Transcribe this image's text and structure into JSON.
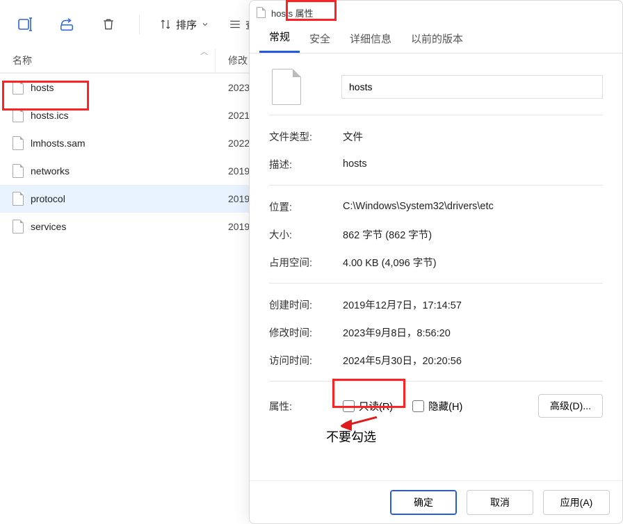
{
  "toolbar": {
    "sort_label": "排序",
    "view_btn_fragment": "查"
  },
  "columns": {
    "name": "名称",
    "modified_fragment": "修改日"
  },
  "files": [
    {
      "name": "hosts",
      "modified_fragment": "2023"
    },
    {
      "name": "hosts.ics",
      "modified_fragment": "2021"
    },
    {
      "name": "lmhosts.sam",
      "modified_fragment": "2022"
    },
    {
      "name": "networks",
      "modified_fragment": "2019"
    },
    {
      "name": "protocol",
      "modified_fragment": "2019"
    },
    {
      "name": "services",
      "modified_fragment": "2019"
    }
  ],
  "properties": {
    "window_title": "hosts 属性",
    "tabs": {
      "general": "常规",
      "security": "安全",
      "details": "详细信息",
      "previous": "以前的版本"
    },
    "name_value": "hosts",
    "labels": {
      "type": "文件类型:",
      "desc": "描述:",
      "location": "位置:",
      "size": "大小:",
      "size_on_disk": "占用空间:",
      "created": "创建时间:",
      "modified": "修改时间:",
      "accessed": "访问时间:",
      "attributes": "属性:"
    },
    "values": {
      "type": "文件",
      "desc": "hosts",
      "location": "C:\\Windows\\System32\\drivers\\etc",
      "size": "862 字节 (862 字节)",
      "size_on_disk": "4.00 KB (4,096 字节)",
      "created": "2019年12月7日，17:14:57",
      "modified": "2023年9月8日，8:56:20",
      "accessed": "2024年5月30日，20:20:56"
    },
    "checkbox_readonly": "只读(R)",
    "checkbox_hidden": "隐藏(H)",
    "advanced_btn": "高级(D)...",
    "footer": {
      "ok": "确定",
      "cancel": "取消",
      "apply": "应用(A)"
    }
  },
  "annotations": {
    "note_text": "不要勾选"
  }
}
